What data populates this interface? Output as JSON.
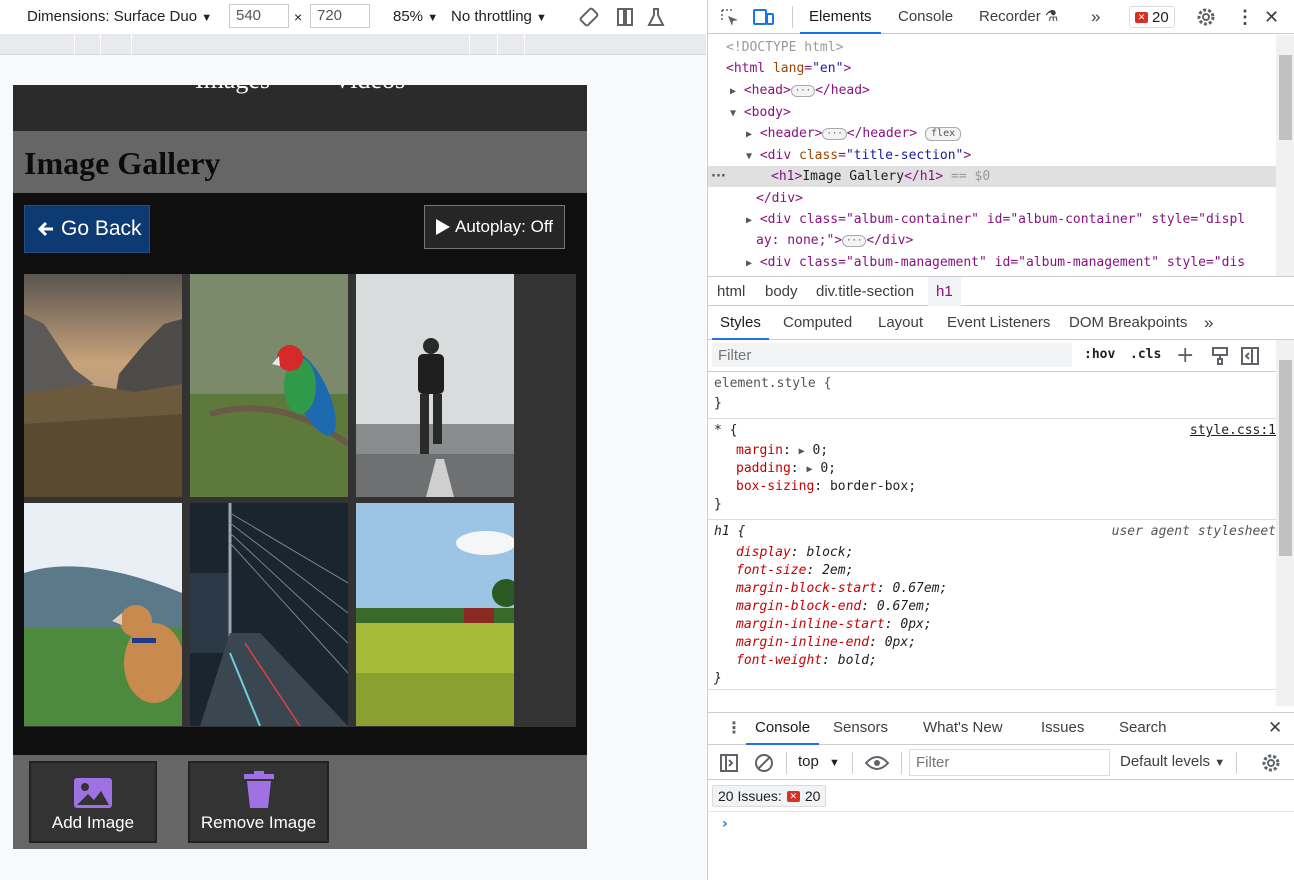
{
  "device_toolbar": {
    "dimensions_label": "Dimensions: Surface Duo",
    "width_value": "540",
    "height_value": "720",
    "times_sign": "×",
    "zoom": "85%",
    "throttling": "No throttling"
  },
  "page": {
    "nav_links": [
      "Images",
      "Videos"
    ],
    "title": "Image Gallery",
    "back_button": "Go Back",
    "autoplay_button": "Autoplay: Off",
    "add_image_button": "Add Image",
    "remove_image_button": "Remove Image",
    "photos": [
      "mountain-valley",
      "parrot",
      "runner",
      "dog",
      "bridge-night",
      "field-barn"
    ]
  },
  "devtools": {
    "tabs": [
      "Elements",
      "Console",
      "Recorder",
      "20"
    ],
    "active_tab": "Elements",
    "dom": {
      "doctype": "<!DOCTYPE html>",
      "html_open": "<html ",
      "html_attr": "lang",
      "html_val": "\"en\"",
      "head": "<head>",
      "head_close": "</head>",
      "body": "<body>",
      "header": "<header>",
      "header_close": "</header>",
      "flex_badge": "flex",
      "div_title": "<div ",
      "class_attr": "class",
      "title_class": "\"title-section\"",
      "h1_open": "<h1>",
      "h1_text": "Image Gallery",
      "h1_close": "</h1>",
      "eq_var": "== $0",
      "div_close": "</div>",
      "album_line1": "<div class=\"album-container\" id=\"album-container\" style=\"displ",
      "album_line2": "ay: none;\">",
      "mgmt_line": "<div class=\"album-management\" id=\"album-management\" style=\"dis"
    },
    "breadcrumbs": [
      "html",
      "body",
      "div.title-section",
      "h1"
    ],
    "styles_tabs": [
      "Styles",
      "Computed",
      "Layout",
      "Event Listeners",
      "DOM Breakpoints"
    ],
    "filter_placeholder": "Filter",
    "hov": ":hov",
    "cls": ".cls",
    "styles": {
      "element_style": "element.style {",
      "close_brace": "}",
      "star_selector": "* {",
      "star_source": "style.css:1",
      "margin": "margin",
      "padding": "padding",
      "box_sizing": "box-sizing",
      "zero": "0;",
      "border_box": "border-box;",
      "h1_selector": "h1 {",
      "ua": "user agent stylesheet",
      "ua_rules": [
        [
          "display",
          "block;"
        ],
        [
          "font-size",
          "2em;"
        ],
        [
          "margin-block-start",
          "0.67em;"
        ],
        [
          "margin-block-end",
          "0.67em;"
        ],
        [
          "margin-inline-start",
          "0px;"
        ],
        [
          "margin-inline-end",
          "0px;"
        ],
        [
          "font-weight",
          "bold;"
        ]
      ]
    },
    "drawer": {
      "tabs": [
        "Console",
        "Sensors",
        "What's New",
        "Issues",
        "Search"
      ],
      "context": "top",
      "filter_placeholder": "Filter",
      "levels": "Default levels",
      "issues_label": "20 Issues:",
      "issues_count": "20"
    }
  }
}
